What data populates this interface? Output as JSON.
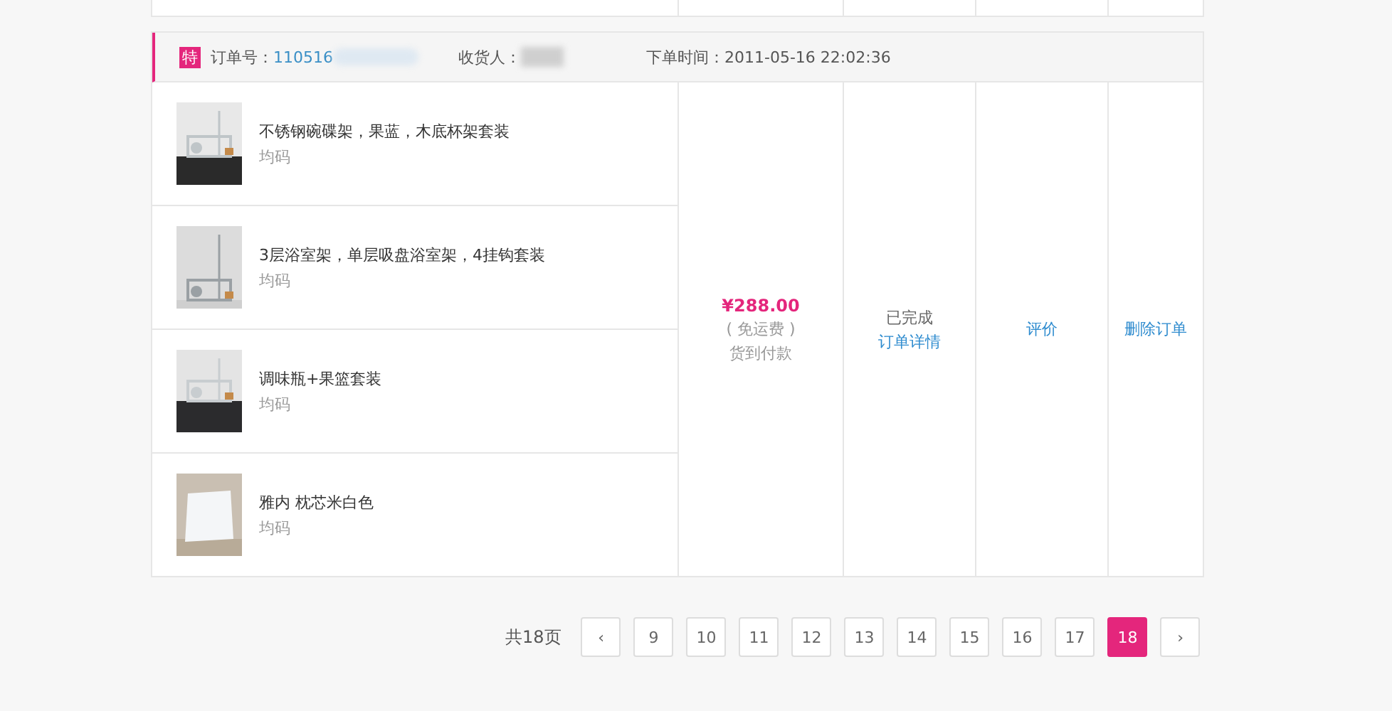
{
  "order": {
    "badge": "特",
    "order_no_label": "订单号：",
    "order_no": "110516",
    "recipient_label": "收货人：",
    "order_time": "下单时间：2011-05-16 22:02:36",
    "items": [
      {
        "name": "不锈钢碗碟架，果蓝，木底杯架套装",
        "spec": "均码",
        "kind": "picture"
      },
      {
        "name": "3层浴室架，单层吸盘浴室架，4挂钩套装",
        "spec": "均码",
        "kind": "picture"
      },
      {
        "name": "调味瓶+果篮套装",
        "spec": "均码",
        "kind": "picture"
      },
      {
        "name": "雅内 枕芯米白色",
        "spec": "均码",
        "kind": "picture"
      }
    ],
    "price": "¥288.00",
    "shipping": "( 免运费 )",
    "payment": "货到付款",
    "status": "已完成",
    "detail_link": "订单详情",
    "review_link": "评价",
    "delete_link": "删除订单"
  },
  "pagination": {
    "total": "共18页",
    "prev": "‹",
    "next": "›",
    "pages": [
      {
        "label": "9",
        "selected": false
      },
      {
        "label": "10",
        "selected": false
      },
      {
        "label": "11",
        "selected": false
      },
      {
        "label": "12",
        "selected": false
      },
      {
        "label": "13",
        "selected": false
      },
      {
        "label": "14",
        "selected": false
      },
      {
        "label": "15",
        "selected": false
      },
      {
        "label": "16",
        "selected": false
      },
      {
        "label": "17",
        "selected": false
      },
      {
        "label": "18",
        "selected": true
      }
    ]
  }
}
